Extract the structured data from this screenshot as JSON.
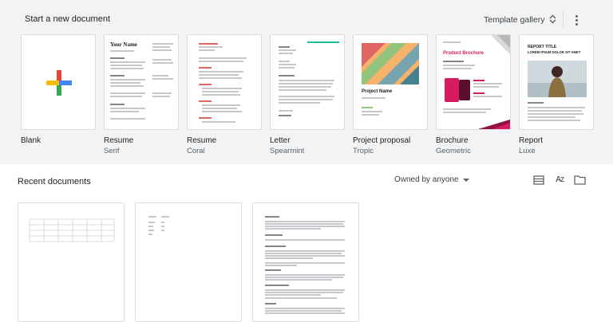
{
  "header": {
    "start_title": "Start a new document",
    "gallery_label": "Template gallery",
    "gallery_icon": "unfold-more-icon",
    "more_icon": "more-vert-icon"
  },
  "templates": [
    {
      "name": "Blank",
      "sub": ""
    },
    {
      "name": "Resume",
      "sub": "Serif",
      "heading": "Your Name"
    },
    {
      "name": "Resume",
      "sub": "Coral"
    },
    {
      "name": "Letter",
      "sub": "Spearmint"
    },
    {
      "name": "Project proposal",
      "sub": "Tropic",
      "heading": "Project Name"
    },
    {
      "name": "Brochure",
      "sub": "Geometric",
      "heading": "Product Brochure"
    },
    {
      "name": "Report",
      "sub": "Luxe",
      "heading": "REPORT TITLE",
      "subheading": "LOREM IPSUM DOLOR SIT AMET"
    }
  ],
  "recent": {
    "title": "Recent documents",
    "owner_filter": "Owned by anyone",
    "icons": [
      "list-view-icon",
      "sort-az-icon",
      "folder-icon"
    ]
  },
  "colors": {
    "background_top": "#f1f3f4",
    "google_red": "#ea4335",
    "google_yellow": "#fbbc04",
    "google_green": "#34a853",
    "google_blue": "#4285f4",
    "coral": "#e06666",
    "spearmint": "#1abc9c",
    "brochure_accent": "#d81b60"
  }
}
